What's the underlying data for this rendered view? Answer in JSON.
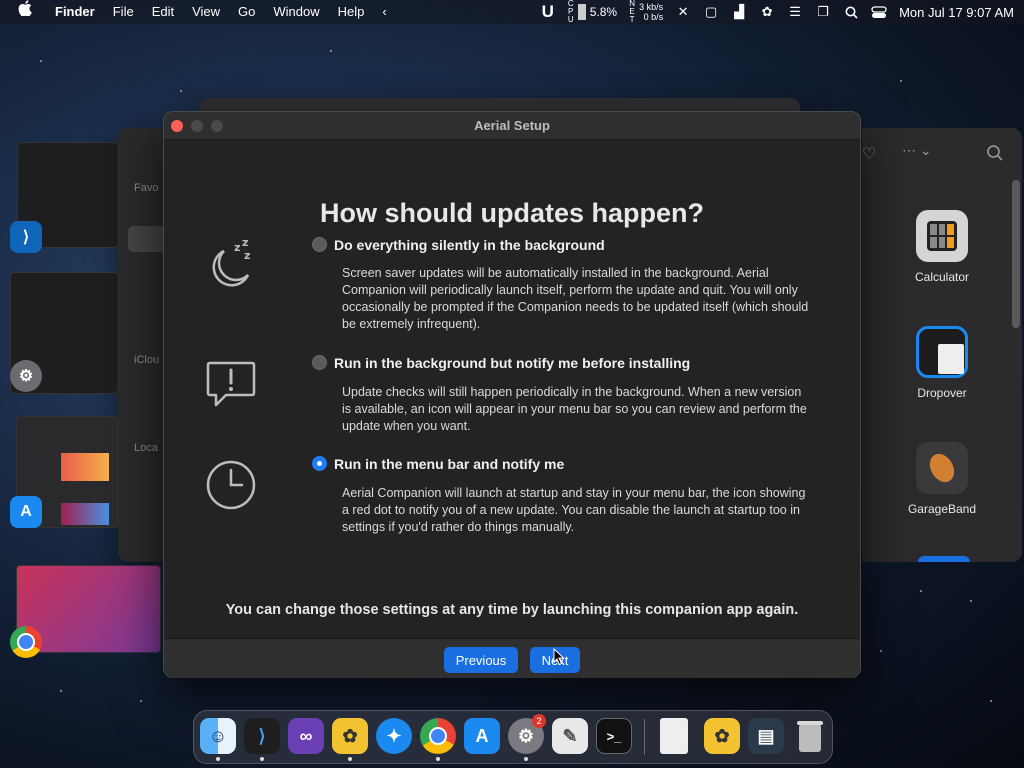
{
  "menubar": {
    "apple": "",
    "app_name": "Finder",
    "menus": [
      "File",
      "Edit",
      "View",
      "Go",
      "Window",
      "Help"
    ],
    "cpu_label": "CPU",
    "cpu_percent": "5.8%",
    "net_label": "NET",
    "net_up": "3 kb/s",
    "net_down": "0 b/s",
    "datetime": "Mon Jul 17  9:07 AM"
  },
  "finder_right": {
    "apps": [
      {
        "label": "Calculator",
        "icon": "calculator-icon"
      },
      {
        "label": "Dropover",
        "icon": "dropover-icon"
      },
      {
        "label": "GarageBand",
        "icon": "guitar-icon"
      }
    ]
  },
  "finder_bg": {
    "sidebar_labels": [
      "Favo",
      "iClou",
      "Loca"
    ]
  },
  "dialog": {
    "title": "Aerial Setup",
    "heading": "How should updates happen?",
    "options": [
      {
        "title": "Do everything silently in the background",
        "description": "Screen saver updates will be automatically installed in the background. Aerial Companion will periodically launch itself, perform the update and quit. You will only occasionally be prompted if the Companion needs to be updated itself (which should be extremely infrequent).",
        "selected": false,
        "icon": "sleep-moon-icon"
      },
      {
        "title": "Run in the background but notify me before installing",
        "description": "Update checks will still happen periodically in the background. When a new version is available, an icon will appear in your menu bar so you can review and perform the update when you want.",
        "selected": false,
        "icon": "alert-bubble-icon"
      },
      {
        "title": "Run in the menu bar and notify me",
        "description": "Aerial Companion will launch at startup and stay in your menu bar, the icon showing a red dot to notify you of a new update. You can disable the launch at startup too in settings if you'd rather do things manually.",
        "selected": true,
        "icon": "clock-icon"
      }
    ],
    "footer_note": "You can change those settings at any time by launching this companion app again.",
    "previous_label": "Previous",
    "next_label": "Next"
  },
  "dock": {
    "settings_badge": "2"
  },
  "colors": {
    "accent": "#1f7cf5",
    "button": "#1a6fe0"
  }
}
